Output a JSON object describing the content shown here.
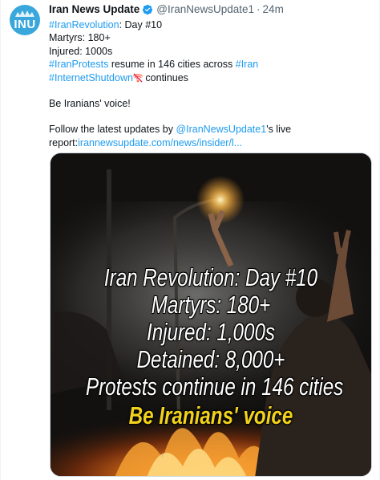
{
  "tweet": {
    "author_name": "Iran News Update",
    "handle": "@IranNewsUpdate1",
    "separator": "·",
    "time": "24m",
    "avatar_text": "INU",
    "lines": {
      "l1_tag": "#IranRevolution",
      "l1_rest": ": Day #10",
      "l2": "Martyrs: 180+",
      "l3": "Injured: 1000s",
      "l4_tag1": "#IranProtests",
      "l4_mid": " resume in 146 cities across ",
      "l4_tag2": "#Iran",
      "l5_tag": "#InternetShutdown",
      "l5_rest": " continues",
      "l6": "Be Iranians' voice!",
      "l7_pre": "Follow the latest updates by ",
      "l7_mention": "@IranNewsUpdate1",
      "l7_post": "'s live",
      "l8_pre": "report:",
      "l8_link": "irannewsupdate.com/news/insider/l..."
    },
    "media_overlay": {
      "line1": "Iran Revolution: Day #10",
      "line2": "Martyrs: 180+",
      "line3": "Injured: 1,000s",
      "line4": "Detained: 8,000+",
      "line5": "Protests continue in 146 cities",
      "line6": "Be Iranians' voice"
    },
    "colors": {
      "link": "#1d9bf0",
      "verified": "#1d9bf0",
      "avatar_bg": "#39a7dc",
      "overlay_highlight": "#f2d21c"
    },
    "icons": [
      "verified-badge-icon",
      "sos-emoji-icon"
    ]
  }
}
